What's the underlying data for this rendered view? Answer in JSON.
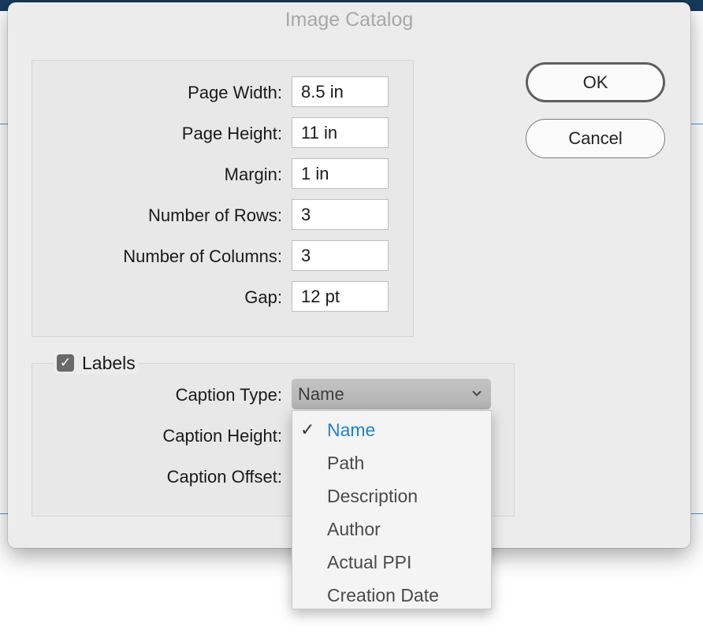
{
  "dialog": {
    "title": "Image Catalog",
    "fields": [
      {
        "label": "Page Width:",
        "value": "8.5 in"
      },
      {
        "label": "Page Height:",
        "value": "11 in"
      },
      {
        "label": "Margin:",
        "value": "1 in"
      },
      {
        "label": "Number of Rows:",
        "value": "3"
      },
      {
        "label": "Number of Columns:",
        "value": "3"
      },
      {
        "label": "Gap:",
        "value": "12 pt"
      }
    ],
    "labels_checkbox": {
      "label": "Labels",
      "checked": true
    },
    "caption_type": {
      "label": "Caption Type:",
      "value": "Name"
    },
    "caption_height": {
      "label": "Caption Height:"
    },
    "caption_offset": {
      "label": "Caption Offset:"
    },
    "buttons": {
      "ok": "OK",
      "cancel": "Cancel"
    },
    "dropdown": {
      "options": [
        "Name",
        "Path",
        "Description",
        "Author",
        "Actual PPI",
        "Creation Date"
      ],
      "selected_index": 0,
      "check_glyph": "✓"
    }
  },
  "colors": {
    "selected_option": "#1e82d6",
    "dialog_bg": "#ececec",
    "title_text": "#a8a8a8"
  },
  "icons": {
    "check": "checkmark-icon",
    "chevron": "chevron-down-icon"
  }
}
